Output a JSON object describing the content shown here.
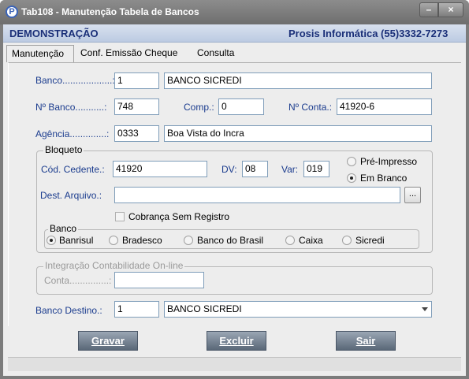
{
  "window": {
    "title": "Tab108 - Manutenção Tabela de Bancos",
    "icon_letter": "P",
    "minimize": "–",
    "close": "×"
  },
  "header": {
    "left": "DEMONSTRAÇÃO",
    "right": "Prosis Informática (55)3332-7273"
  },
  "tabs": [
    {
      "label": "Manutenção"
    },
    {
      "label": "Conf. Emissão Cheque"
    },
    {
      "label": "Consulta"
    }
  ],
  "form": {
    "banco": {
      "label": "Banco...................:",
      "code": "1",
      "name": "BANCO SICREDI"
    },
    "nbanco": {
      "label": "Nº Banco...........:",
      "value": "748"
    },
    "comp": {
      "label": "Comp.:",
      "value": "0"
    },
    "nconta": {
      "label": "Nº Conta.:",
      "value": "41920-6"
    },
    "agencia": {
      "label": "Agência..............:",
      "code": "0333",
      "name": "Boa Vista do Incra"
    },
    "bloqueto": {
      "title": "Bloqueto",
      "cedente_label": "Cód. Cedente.:",
      "cedente": "41920",
      "dv_label": "DV:",
      "dv": "08",
      "var_label": "Var:",
      "var": "019",
      "pre_impresso": "Pré-Impresso",
      "em_branco": "Em Branco",
      "dest_label": "Dest. Arquivo.:",
      "dest": "",
      "dots": "...",
      "cobranca": "Cobrança Sem Registro",
      "banco_group": {
        "title": "Banco",
        "options": [
          "Banrisul",
          "Bradesco",
          "Banco do Brasil",
          "Caixa",
          "Sicredi"
        ],
        "selected": "Banrisul"
      }
    },
    "integracao": {
      "title": "Integração Contabilidade On-line",
      "conta_label": "Conta...............:",
      "conta": ""
    },
    "destino": {
      "label": "Banco Destino.:",
      "code": "1",
      "name": "BANCO SICREDI"
    }
  },
  "buttons": {
    "gravar": "Gravar",
    "excluir": "Excluir",
    "sair": "Sair"
  }
}
